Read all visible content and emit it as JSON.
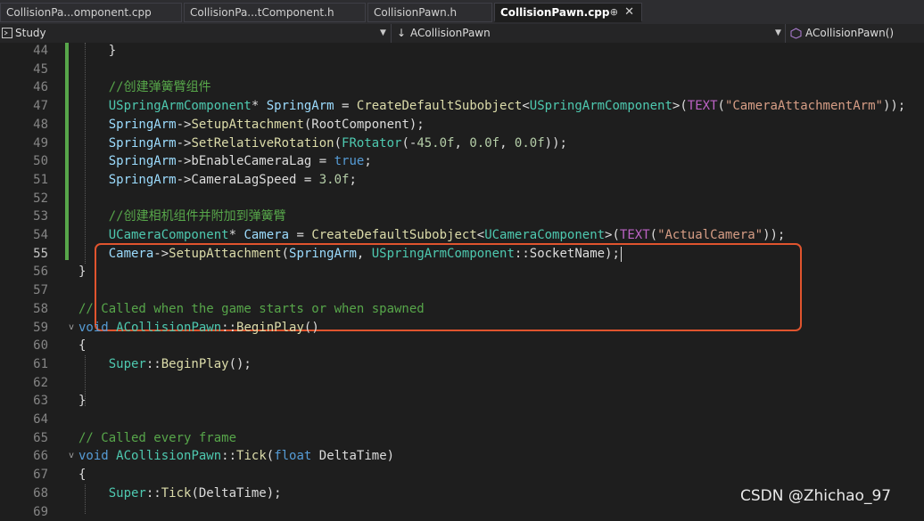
{
  "tabs": [
    {
      "label": "CollisionPa...omponent.cpp",
      "active": false
    },
    {
      "label": "CollisionPa...tComponent.h",
      "active": false
    },
    {
      "label": "CollisionPawn.h",
      "active": false
    },
    {
      "label": "CollisionPawn.cpp",
      "active": true,
      "pin": "⊕",
      "close": "✕"
    }
  ],
  "navbar": {
    "project": "Study",
    "class_scope": "ACollisionPawn",
    "member": "ACollisionPawn()"
  },
  "lines": [
    {
      "n": "44",
      "tokens": [
        [
          "pl",
          "    }"
        ]
      ]
    },
    {
      "n": "45",
      "tokens": []
    },
    {
      "n": "46",
      "tokens": [
        [
          "cm",
          "    //创建弹簧臂组件"
        ]
      ]
    },
    {
      "n": "47",
      "tokens": [
        [
          "ty",
          "    USpringArmComponent"
        ],
        [
          "pl",
          "* "
        ],
        [
          "var",
          "SpringArm"
        ],
        [
          "pl",
          " = "
        ],
        [
          "fn",
          "CreateDefaultSubobject"
        ],
        [
          "pl",
          "<"
        ],
        [
          "ty",
          "USpringArmComponent"
        ],
        [
          "pl",
          ">("
        ],
        [
          "mac",
          "TEXT"
        ],
        [
          "pl",
          "("
        ],
        [
          "str",
          "\"CameraAttachmentArm\""
        ],
        [
          "pl",
          "));"
        ]
      ]
    },
    {
      "n": "48",
      "tokens": [
        [
          "var",
          "    SpringArm"
        ],
        [
          "pl",
          "->"
        ],
        [
          "fn",
          "SetupAttachment"
        ],
        [
          "pl",
          "(RootComponent);"
        ]
      ]
    },
    {
      "n": "49",
      "tokens": [
        [
          "var",
          "    SpringArm"
        ],
        [
          "pl",
          "->"
        ],
        [
          "fn",
          "SetRelativeRotation"
        ],
        [
          "pl",
          "("
        ],
        [
          "ty",
          "FRotator"
        ],
        [
          "pl",
          "(-"
        ],
        [
          "num",
          "45.0f"
        ],
        [
          "pl",
          ", "
        ],
        [
          "num",
          "0.0f"
        ],
        [
          "pl",
          ", "
        ],
        [
          "num",
          "0.0f"
        ],
        [
          "pl",
          "));"
        ]
      ]
    },
    {
      "n": "50",
      "tokens": [
        [
          "var",
          "    SpringArm"
        ],
        [
          "pl",
          "->bEnableCameraLag = "
        ],
        [
          "kw",
          "true"
        ],
        [
          "pl",
          ";"
        ]
      ]
    },
    {
      "n": "51",
      "tokens": [
        [
          "var",
          "    SpringArm"
        ],
        [
          "pl",
          "->CameraLagSpeed = "
        ],
        [
          "num",
          "3.0f"
        ],
        [
          "pl",
          ";"
        ]
      ]
    },
    {
      "n": "52",
      "tokens": []
    },
    {
      "n": "53",
      "tokens": [
        [
          "cm",
          "    //创建相机组件并附加到弹簧臂"
        ]
      ]
    },
    {
      "n": "54",
      "tokens": [
        [
          "ty",
          "    UCameraComponent"
        ],
        [
          "pl",
          "* "
        ],
        [
          "var",
          "Camera"
        ],
        [
          "pl",
          " = "
        ],
        [
          "fn",
          "CreateDefaultSubobject"
        ],
        [
          "pl",
          "<"
        ],
        [
          "ty",
          "UCameraComponent"
        ],
        [
          "pl",
          ">("
        ],
        [
          "mac",
          "TEXT"
        ],
        [
          "pl",
          "("
        ],
        [
          "str",
          "\"ActualCamera\""
        ],
        [
          "pl",
          "));"
        ]
      ]
    },
    {
      "n": "55",
      "tokens": [
        [
          "var",
          "    Camera"
        ],
        [
          "pl",
          "->"
        ],
        [
          "fn",
          "SetupAttachment"
        ],
        [
          "pl",
          "("
        ],
        [
          "var",
          "SpringArm"
        ],
        [
          "pl",
          ", "
        ],
        [
          "ty",
          "USpringArmComponent"
        ],
        [
          "pl",
          "::SocketName);"
        ]
      ]
    },
    {
      "n": "56",
      "tokens": [
        [
          "pl",
          "}"
        ]
      ]
    },
    {
      "n": "57",
      "tokens": []
    },
    {
      "n": "58",
      "tokens": [
        [
          "cm",
          "// Called when the game starts or when spawned"
        ]
      ]
    },
    {
      "n": "59",
      "tokens": [
        [
          "kw",
          "void "
        ],
        [
          "ty",
          "ACollisionPawn"
        ],
        [
          "pl",
          "::"
        ],
        [
          "fn",
          "BeginPlay"
        ],
        [
          "pl",
          "()"
        ]
      ]
    },
    {
      "n": "60",
      "tokens": [
        [
          "pl",
          "{"
        ]
      ]
    },
    {
      "n": "61",
      "tokens": [
        [
          "ty",
          "    Super"
        ],
        [
          "pl",
          "::"
        ],
        [
          "fn",
          "BeginPlay"
        ],
        [
          "pl",
          "();"
        ]
      ]
    },
    {
      "n": "62",
      "tokens": []
    },
    {
      "n": "63",
      "tokens": [
        [
          "pl",
          "}"
        ]
      ]
    },
    {
      "n": "64",
      "tokens": []
    },
    {
      "n": "65",
      "tokens": [
        [
          "cm",
          "// Called every frame"
        ]
      ]
    },
    {
      "n": "66",
      "tokens": [
        [
          "kw",
          "void "
        ],
        [
          "ty",
          "ACollisionPawn"
        ],
        [
          "pl",
          "::"
        ],
        [
          "fn",
          "Tick"
        ],
        [
          "pl",
          "("
        ],
        [
          "kw",
          "float "
        ],
        [
          "pl",
          "DeltaTime)"
        ]
      ]
    },
    {
      "n": "67",
      "tokens": [
        [
          "pl",
          "{"
        ]
      ]
    },
    {
      "n": "68",
      "tokens": [
        [
          "ty",
          "    Super"
        ],
        [
          "pl",
          "::"
        ],
        [
          "fn",
          "Tick"
        ],
        [
          "pl",
          "(DeltaTime);"
        ]
      ]
    },
    {
      "n": "69",
      "tokens": []
    }
  ],
  "current_line": "55",
  "fold_markers": [
    "59",
    "66"
  ],
  "fold_glyph": "v",
  "watermark": "CSDN @Zhichao_97",
  "colors": {
    "background": "#1e1e1e",
    "comment": "#57a64a",
    "keyword": "#569cd6",
    "type": "#4ec9b0",
    "function": "#dcdcaa",
    "string": "#d69d85",
    "highlight_box": "#e0542e"
  }
}
